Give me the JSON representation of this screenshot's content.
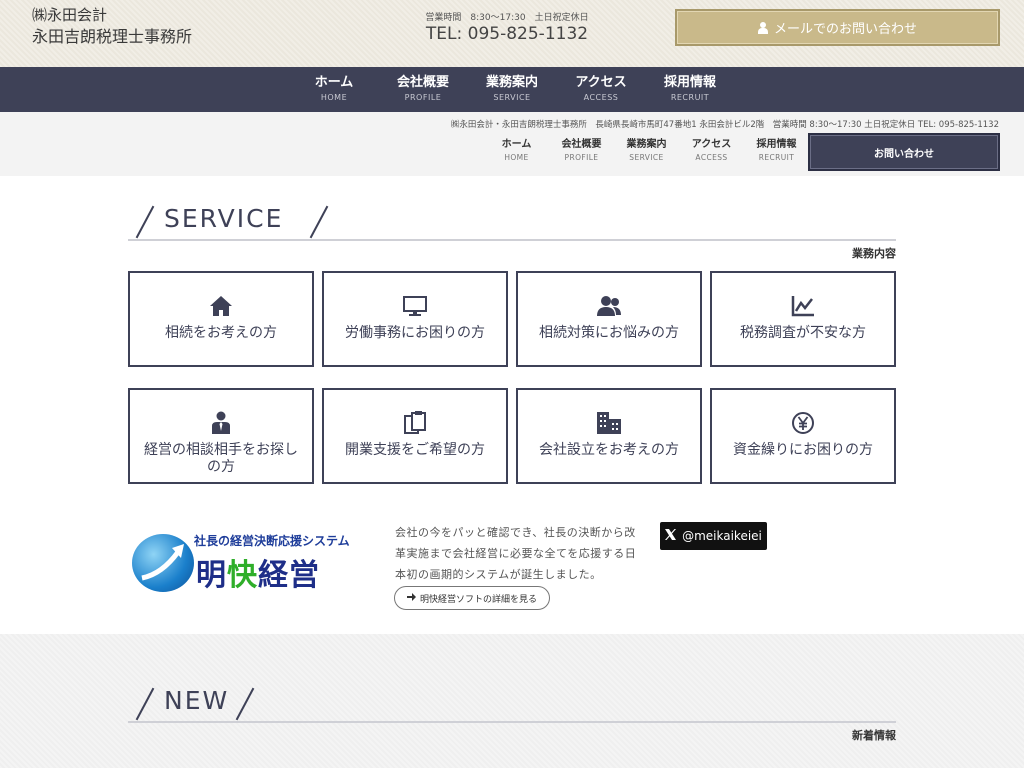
{
  "header": {
    "logo_line1": "㈱永田会計",
    "logo_line2": "永田吉朗税理士事務所",
    "hours": "営業時間　8:30〜17:30　土日祝定休日",
    "tel": "TEL: 095-825-1132",
    "mail_button": "メールでのお問い合わせ"
  },
  "nav": [
    {
      "jp": "ホーム",
      "en": "HOME"
    },
    {
      "jp": "会社概要",
      "en": "PROFILE"
    },
    {
      "jp": "業務案内",
      "en": "SERVICE"
    },
    {
      "jp": "アクセス",
      "en": "ACCESS"
    },
    {
      "jp": "採用情報",
      "en": "RECRUIT"
    }
  ],
  "subheader": {
    "info": "㈱永田会計・永田吉朗税理士事務所　長崎県長崎市馬町47番地1 永田会計ビル2階　営業時間 8:30〜17:30 土日祝定休日 TEL: 095-825-1132",
    "contact_button": "お問い合わせ"
  },
  "service": {
    "title": "SERVICE",
    "subtitle": "業務内容",
    "cards": [
      {
        "label": "相続をお考えの方",
        "icon": "home-icon"
      },
      {
        "label": "労働事務にお困りの方",
        "icon": "monitor-icon"
      },
      {
        "label": "相続対策にお悩みの方",
        "icon": "users-icon"
      },
      {
        "label": "税務調査が不安な方",
        "icon": "chart-line-icon"
      },
      {
        "label": "経営の相談相手をお探しの方",
        "icon": "businessman-icon"
      },
      {
        "label": "開業支援をご希望の方",
        "icon": "clipboard-icon"
      },
      {
        "label": "会社設立をお考えの方",
        "icon": "building-icon"
      },
      {
        "label": "資金繰りにお困りの方",
        "icon": "yen-icon"
      }
    ]
  },
  "meikai": {
    "banner_tag": "社長の経営決断応援システム",
    "banner_name_1": "明",
    "banner_name_2": "快",
    "banner_name_3": "経営",
    "text": "会社の今をパッと確認でき、社長の決断から改革実施まで会社経営に必要な全てを応援する日本初の画期的システムが誕生しました。",
    "detail_button": "明快経営ソフトの詳細を見る",
    "x_handle": "@meikaikeiei"
  },
  "news": {
    "title": "NEW",
    "subtitle": "新着情報"
  }
}
